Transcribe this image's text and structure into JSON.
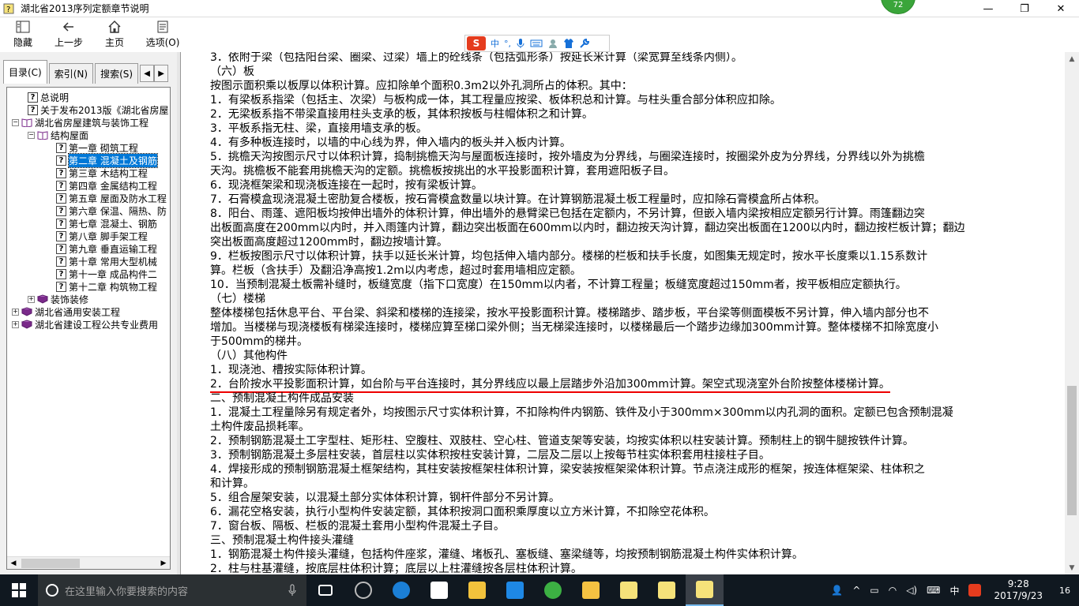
{
  "window": {
    "title": "湖北省2013序列定额章节说明",
    "badge": "72",
    "minimize": "—",
    "restore": "❐",
    "close": "✕"
  },
  "toolbar": {
    "hide_label": "隐藏",
    "back_label": "上一步",
    "home_label": "主页",
    "options_label": "选项(O)"
  },
  "ime": {
    "logo": "S",
    "lang": "中",
    "punct": "°,"
  },
  "tabs": {
    "contents": "目录(C)",
    "index": "索引(N)",
    "search": "搜索(S)",
    "prev": "◀",
    "next": "▶"
  },
  "tree": [
    {
      "label": "总说明"
    },
    {
      "label": "关于发布2013版《湖北省房屋"
    },
    {
      "label": "湖北省房屋建筑与装饰工程"
    },
    {
      "label": "结构屋面"
    },
    {
      "label": "第一章 砌筑工程"
    },
    {
      "label": "第二章 混凝土及钢筋"
    },
    {
      "label": "第三章 木结构工程"
    },
    {
      "label": "第四章 金属结构工程"
    },
    {
      "label": "第五章 屋面及防水工程"
    },
    {
      "label": "第六章 保温、隔热、防"
    },
    {
      "label": "第七章 混凝土、钢筋"
    },
    {
      "label": "第八章 脚手架工程"
    },
    {
      "label": "第九章 垂直运输工程"
    },
    {
      "label": "第十章 常用大型机械"
    },
    {
      "label": "第十一章 成品构件二"
    },
    {
      "label": "第十二章 构筑物工程"
    },
    {
      "label": "装饰装修"
    },
    {
      "label": "湖北省通用安装工程"
    },
    {
      "label": "湖北省建设工程公共专业费用"
    }
  ],
  "content": {
    "lines": [
      "3．依附于梁（包括阳台梁、圈梁、过梁）墙上的砼线条（包括弧形条）按延长米计算（梁宽算至线条内侧）。",
      "（六）板",
      "按图示面积乘以板厚以体积计算。应扣除单个面积0.3m2以外孔洞所占的体积。其中：",
      "1．有梁板系指梁（包括主、次梁）与板构成一体，其工程量应按梁、板体积总和计算。与柱头重合部分体积应扣除。",
      "2．无梁板系指不带梁直接用柱头支承的板，其体积按板与柱帽体积之和计算。",
      "3．平板系指无柱、梁，直接用墙支承的板。",
      "4．有多种板连接时，以墙的中心线为界，伸入墙内的板头并入板内计算。",
      "5．挑檐天沟按图示尺寸以体积计算，捣制挑檐天沟与屋面板连接时，按外墙皮为分界线，与圈梁连接时，按圈梁外皮为分界线，分界线以外为挑檐",
      "天沟。挑檐板不能套用挑檐天沟的定额。挑檐板按挑出的水平投影面积计算，套用遮阳板子目。",
      "6．现浇框架梁和现浇板连接在一起时，按有梁板计算。",
      "7．石膏模盒现浇混凝土密肋复合楼板，按石膏模盒数量以块计算。在计算钢筋混凝土板工程量时，应扣除石膏模盒所占体积。",
      "8．阳台、雨蓬、遮阳板均按伸出墙外的体积计算，伸出墙外的悬臂梁已包括在定额内，不另计算，但嵌入墙内梁按相应定额另行计算。雨篷翻边突",
      "出板面高度在200mm以内时，并入雨篷内计算，翻边突出板面在600mm以内时，翻边按天沟计算，翻边突出板面在1200以内时，翻边按栏板计算；翻边",
      "突出板面高度超过1200mm时，翻边按墙计算。",
      "9．栏板按图示尺寸以体积计算，扶手以延长米计算，均包括伸入墙内部分。楼梯的栏板和扶手长度，如图集无规定时，按水平长度乘以1.15系数计",
      "算。栏板（含扶手）及翻沿净高按1.2m以内考虑，超过时套用墙相应定额。",
      "10．当预制混凝土板需补缝时，板缝宽度（指下口宽度）在150mm以内者，不计算工程量；板缝宽度超过150mm者，按平板相应定额执行。",
      "（七）楼梯",
      "整体楼梯包括休息平台、平台梁、斜梁和楼梯的连接梁，按水平投影面积计算。楼梯踏步、踏步板，平台梁等侧面模板不另计算，伸入墙内部分也不",
      "增加。当楼梯与现浇楼板有梯梁连接时，楼梯应算至梯口梁外侧；当无梯梁连接时，以楼梯最后一个踏步边缘加300mm计算。整体楼梯不扣除宽度小",
      "于500mm的梯井。",
      "（八）其他构件",
      "1．现浇池、槽按实际体积计算。",
      "2．台阶按水平投影面积计算，如台阶与平台连接时，其分界线应以最上层踏步外沿加300mm计算。架空式现浇室外台阶按整体楼梯计算。",
      "二、预制混凝土构件成品安装",
      "1．混凝土工程量除另有规定者外，均按图示尺寸实体积计算，不扣除构件内钢筋、铁件及小于300mm×300mm以内孔洞的面积。定额已包含预制混凝",
      "土构件废品损耗率。",
      "2．预制钢筋混凝土工字型柱、矩形柱、空腹柱、双肢柱、空心柱、管道支架等安装，均按实体积以柱安装计算。预制柱上的钢牛腿按铁件计算。",
      "3．预制钢筋混凝土多层柱安装，首层柱以实体积按柱安装计算，二层及二层以上按每节柱实体积套用柱接柱子目。",
      "4．焊接形成的预制钢筋混凝土框架结构，其柱安装按框架柱体积计算，梁安装按框架梁体积计算。节点浇注成形的框架，按连体框架梁、柱体积之",
      "和计算。",
      "5．组合屋架安装，以混凝土部分实体体积计算，钢杆件部分不另计算。",
      "6．漏花空格安装，执行小型构件安装定额，其体积按洞口面积乘厚度以立方米计算，不扣除空花体积。",
      "7．窗台板、隔板、栏板的混凝土套用小型构件混凝土子目。",
      "三、预制混凝土构件接头灌缝",
      "1．钢筋混凝土构件接头灌缝，包括构件座浆，灌缝、堵板孔、塞板缝、塞梁缝等，均按预制钢筋混凝土构件实体积计算。",
      "2．柱与柱基灌缝，按底层柱体积计算；底层以上柱灌缝按各层柱体积计算。"
    ]
  },
  "taskbar": {
    "search_placeholder": "在这里输入你要搜索的内容",
    "ime_lang": "中",
    "time": "9:28",
    "date": "2017/9/23",
    "notif_count": "16"
  },
  "colors": {
    "underline": "#e00000",
    "selection": "#0078d7",
    "taskbar": "#101820"
  }
}
